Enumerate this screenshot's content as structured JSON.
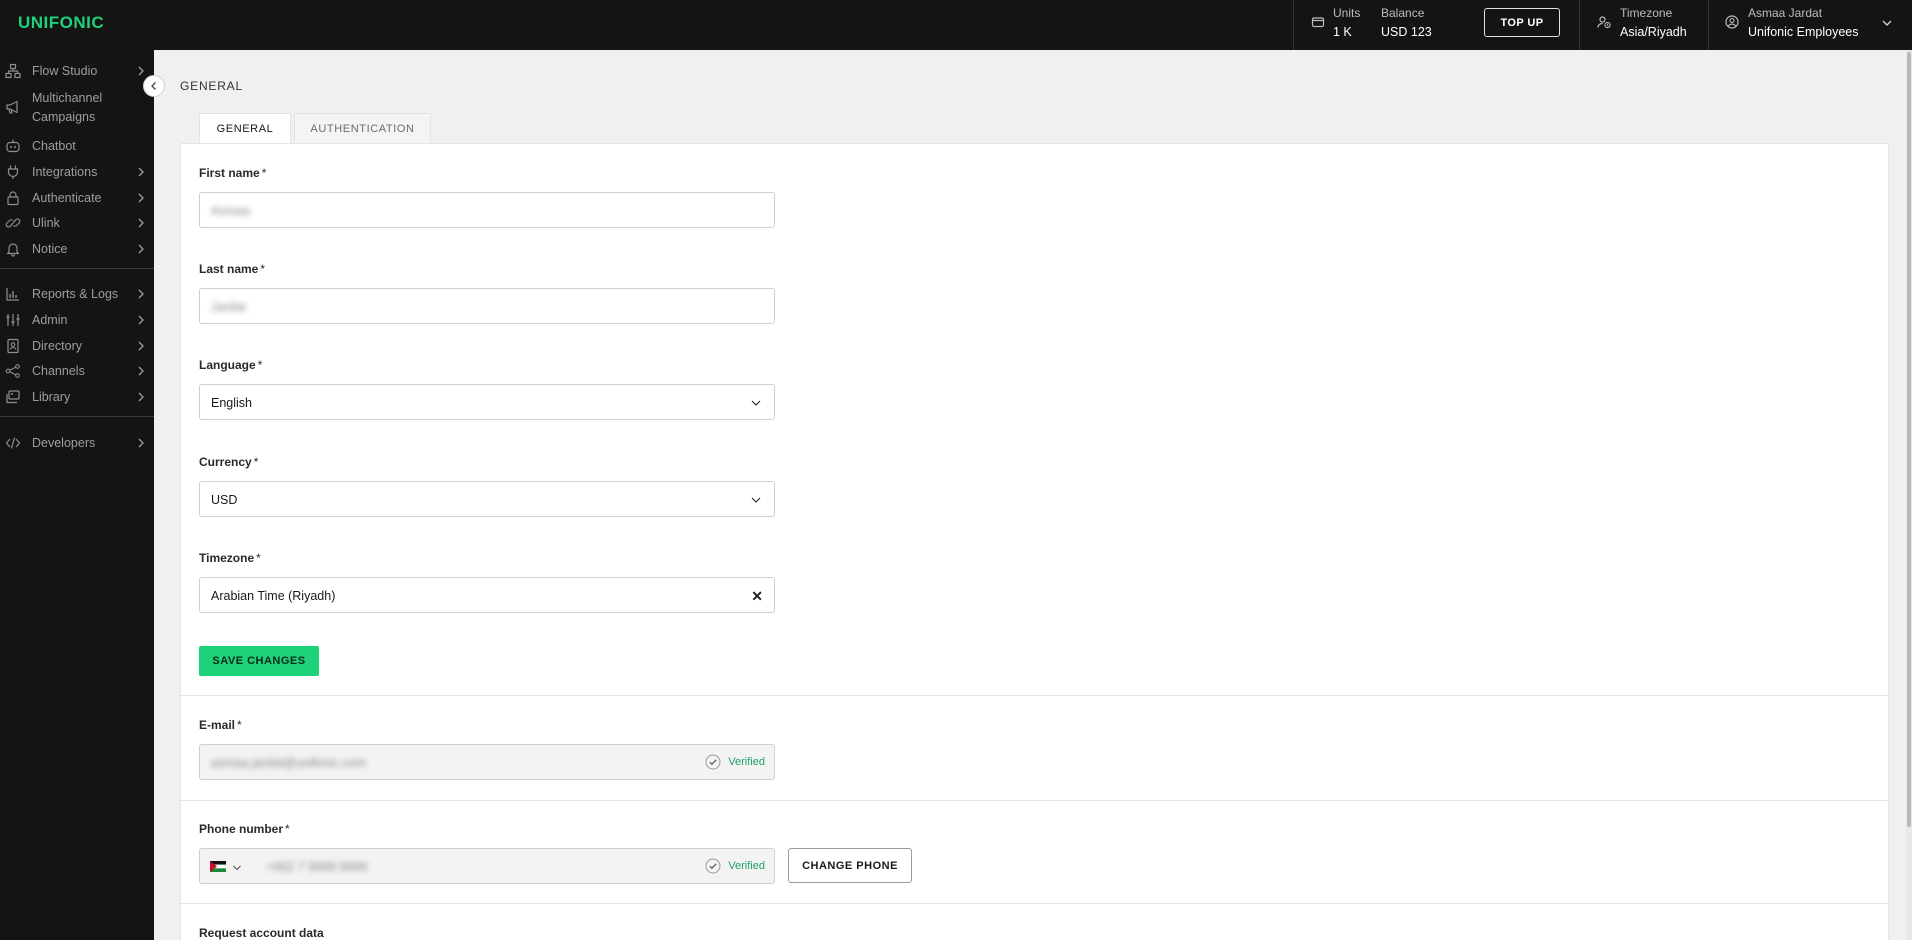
{
  "topbar": {
    "logo": "UNIFONIC",
    "units_label": "Units",
    "units_value": "1 K",
    "balance_label": "Balance",
    "balance_value": "USD 123",
    "topup_label": "TOP UP",
    "timezone_label": "Timezone",
    "timezone_value": "Asia/Riyadh",
    "user_name": "Asmaa Jardat",
    "user_org": "Unifonic Employees"
  },
  "sidebar": {
    "items": [
      {
        "label": "Flow Studio",
        "icon": "flow-icon"
      },
      {
        "label": "Multichannel",
        "label2": "Campaigns",
        "icon": "megaphone-icon"
      },
      {
        "label": "Chatbot",
        "icon": "bot-icon"
      },
      {
        "label": "Integrations",
        "icon": "plug-icon"
      },
      {
        "label": "Authenticate",
        "icon": "lock-icon"
      },
      {
        "label": "Ulink",
        "icon": "link-icon"
      },
      {
        "label": "Notice",
        "icon": "bell-icon"
      },
      {
        "label": "Reports & Logs",
        "icon": "chart-icon"
      },
      {
        "label": "Admin",
        "icon": "sliders-icon"
      },
      {
        "label": "Directory",
        "icon": "contacts-icon"
      },
      {
        "label": "Channels",
        "icon": "network-icon"
      },
      {
        "label": "Library",
        "icon": "library-icon"
      },
      {
        "label": "Developers",
        "icon": "code-icon"
      }
    ]
  },
  "page": {
    "title": "GENERAL",
    "tabs": [
      "GENERAL",
      "AUTHENTICATION"
    ]
  },
  "form": {
    "first_name_label": "First name",
    "first_name_value": "Asmaa",
    "last_name_label": "Last name",
    "last_name_value": "Jardat",
    "language_label": "Language",
    "language_value": "English",
    "currency_label": "Currency",
    "currency_value": "USD",
    "timezone_label": "Timezone",
    "timezone_value": "Arabian Time (Riyadh)",
    "required_mark": "*",
    "save_label": "SAVE CHANGES",
    "email_label": "E-mail",
    "email_value": "asmaa.jardat@unifonic.com",
    "verified_text": "Verified",
    "phone_label": "Phone number",
    "phone_value": "+962 7 9999 9999",
    "change_phone_label": "CHANGE PHONE",
    "request_data_label": "Request account data"
  },
  "colors": {
    "accent": "#1ed27a",
    "verified": "#1aa266",
    "sidebar_bg": "#141414"
  }
}
